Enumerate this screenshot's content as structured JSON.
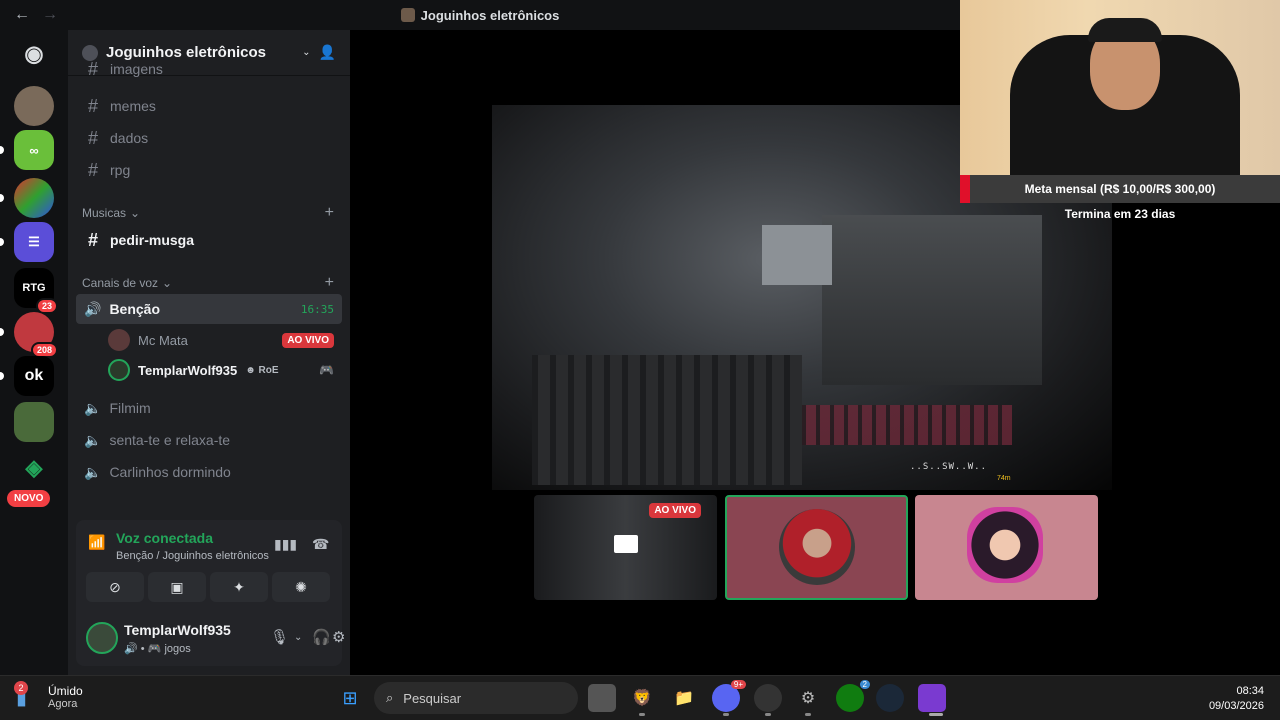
{
  "window": {
    "title": "Joguinhos eletrônicos",
    "back": "←",
    "forward": "→"
  },
  "server": {
    "name": "Joguinhos eletrônicos"
  },
  "rail": {
    "badges": [
      "23",
      "208"
    ],
    "novo": "NOVO"
  },
  "channels": {
    "text_partial": "imagens",
    "text": [
      "memes",
      "dados",
      "rpg"
    ],
    "musicas_category": "Musicas",
    "musicas_channel": "pedir-musga",
    "voice_category": "Canais de voz",
    "active_voice": "Benção",
    "active_timer": "16:35",
    "members": [
      {
        "name": "Mc Mata",
        "tag": "AO VIVO"
      },
      {
        "name": "TemplarWolf935",
        "tag": "RoE"
      }
    ],
    "other_voice": [
      "Filmim",
      "senta-te e relaxa-te",
      "Carlinhos dormindo"
    ]
  },
  "voice_panel": {
    "title": "Voz conectada",
    "subtitle": "Benção / Joguinhos eletrônicos"
  },
  "user_panel": {
    "name": "TemplarWolf935",
    "status": "jogos"
  },
  "stage": {
    "compass": "..S..SW..W..",
    "distance": "74m",
    "thumb_live": "AO VIVO"
  },
  "overlay": {
    "goal": "Meta mensal (R$ 10,00/R$ 300,00)",
    "ends": "Termina em 23 dias"
  },
  "taskbar": {
    "weather_title": "Úmido",
    "weather_sub": "Agora",
    "weather_badge": "2",
    "search_placeholder": "Pesquisar",
    "discord_badge": "9+",
    "xbox_badge": "2",
    "time": "08:34",
    "date": "09/03/2026"
  }
}
